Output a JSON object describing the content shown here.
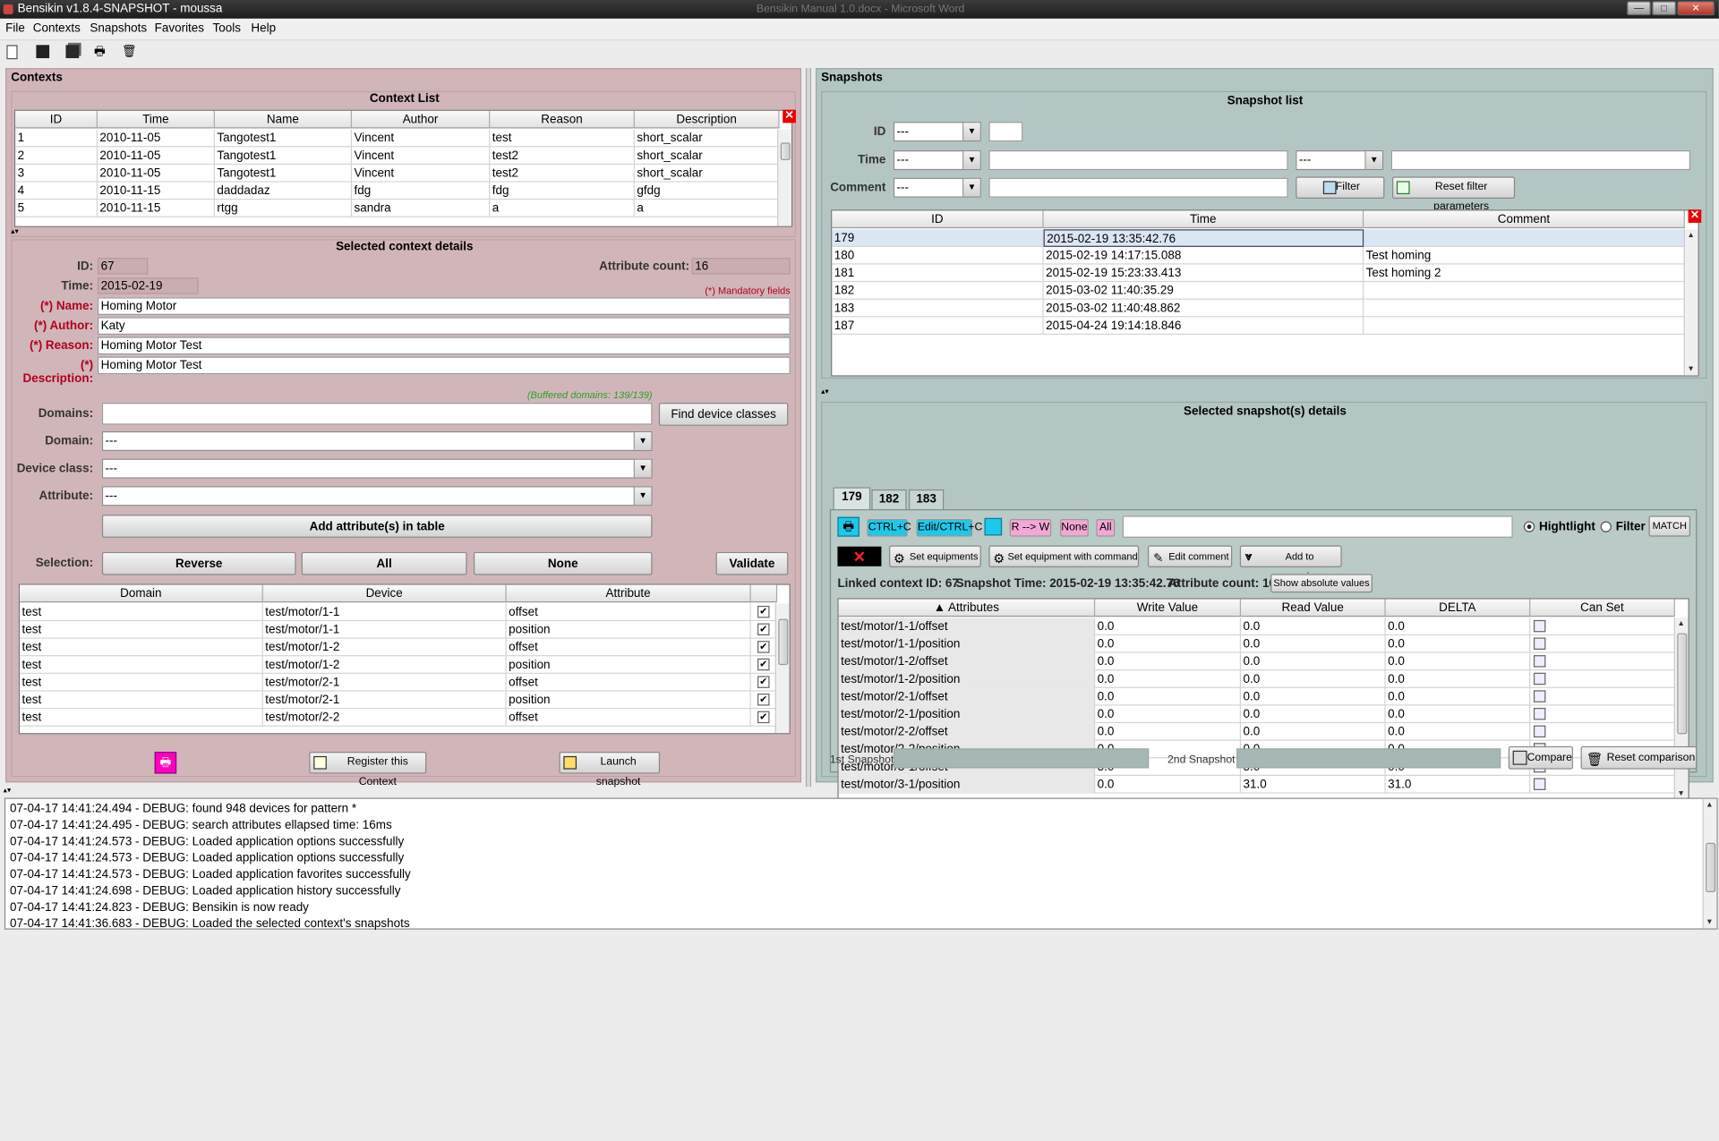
{
  "window": {
    "title": "Bensikin v1.8.4-SNAPSHOT - moussa",
    "ghost_title": "Bensikin Manual 1.0.docx - Microsoft Word"
  },
  "menu": [
    "File",
    "Contexts",
    "Snapshots",
    "Favorites",
    "Tools",
    "Help"
  ],
  "contexts": {
    "group_title": "Contexts",
    "list_title": "Context List",
    "columns": [
      "ID",
      "Time",
      "Name",
      "Author",
      "Reason",
      "Description"
    ],
    "rows": [
      [
        "1",
        "2010-11-05",
        "Tangotest1",
        "Vincent",
        "test",
        "short_scalar"
      ],
      [
        "2",
        "2010-11-05",
        "Tangotest1",
        "Vincent",
        "test2",
        "short_scalar"
      ],
      [
        "3",
        "2010-11-05",
        "Tangotest1",
        "Vincent",
        "test2",
        "short_scalar"
      ],
      [
        "4",
        "2010-11-15",
        "daddadaz",
        "fdg",
        "fdg",
        "gfdg"
      ],
      [
        "5",
        "2010-11-15",
        "rtgg",
        "sandra",
        "a",
        "a"
      ]
    ],
    "details_title": "Selected context details",
    "id_label": "ID:",
    "id": "67",
    "attr_count_label": "Attribute count:",
    "attr_count": "16",
    "time_label": "Time:",
    "time": "2015-02-19",
    "mandatory_note": "(*) Mandatory fields",
    "name_label": "(*) Name:",
    "name": "Homing Motor",
    "author_label": "(*) Author:",
    "author": "Katy",
    "reason_label": "(*) Reason:",
    "reason": "Homing Motor Test",
    "description_label": "(*) Description:",
    "description": "Homing Motor Test",
    "buffered_domains": "(Buffered domains: 139/139)",
    "domains_label": "Domains:",
    "domains_value": "",
    "find_device_classes": "Find device classes",
    "domain_label": "Domain:",
    "domain_value": "---",
    "device_class_label": "Device class:",
    "device_class_value": "---",
    "attribute_label": "Attribute:",
    "attribute_value": "---",
    "add_attributes": "Add attribute(s) in table",
    "selection_label": "Selection:",
    "reverse": "Reverse",
    "all": "All",
    "none": "None",
    "validate": "Validate",
    "attr_columns": [
      "Domain",
      "Device",
      "Attribute"
    ],
    "attr_rows": [
      [
        "test",
        "test/motor/1-1",
        "offset"
      ],
      [
        "test",
        "test/motor/1-1",
        "position"
      ],
      [
        "test",
        "test/motor/1-2",
        "offset"
      ],
      [
        "test",
        "test/motor/1-2",
        "position"
      ],
      [
        "test",
        "test/motor/2-1",
        "offset"
      ],
      [
        "test",
        "test/motor/2-1",
        "position"
      ],
      [
        "test",
        "test/motor/2-2",
        "offset"
      ]
    ],
    "register": "Register this Context",
    "launch": "Launch snapshot"
  },
  "snapshots": {
    "group_title": "Snapshots",
    "list_title": "Snapshot list",
    "id_label": "ID",
    "time_label": "Time",
    "comment_label": "Comment",
    "combo_default": "---",
    "filter": "Filter",
    "reset_filter": "Reset filter parameters",
    "columns": [
      "ID",
      "Time",
      "Comment"
    ],
    "rows": [
      [
        "179",
        "2015-02-19 13:35:42.76",
        ""
      ],
      [
        "180",
        "2015-02-19 14:17:15.088",
        "Test homing"
      ],
      [
        "181",
        "2015-02-19 15:23:33.413",
        "Test homing 2"
      ],
      [
        "182",
        "2015-03-02 11:40:35.29",
        ""
      ],
      [
        "183",
        "2015-03-02 11:40:48.862",
        ""
      ],
      [
        "187",
        "2015-04-24 19:14:18.846",
        ""
      ]
    ],
    "details_title": "Selected snapshot(s) details",
    "tabs": [
      "179",
      "182",
      "183"
    ],
    "ctrl_c": "CTRL+C",
    "edit_ctrl_c": "Edit/CTRL+C",
    "r_to_w": "R --> W",
    "none": "None",
    "all": "All",
    "highlight": "Hightlight",
    "filter_radio": "Filter",
    "match": "MATCH",
    "set_equipments": "Set equipments",
    "set_equipment_cmd": "Set equipment with command",
    "edit_comment": "Edit comment",
    "add_comparison": "Add to comparison",
    "linked_context": "Linked context ID: 67",
    "snapshot_time": "Snapshot Time: 2015-02-19 13:35:42.76",
    "attribute_count": "Attribute count: 16",
    "show_absolute": "Show absolute values",
    "detail_columns": [
      "Attributes",
      "Write Value",
      "Read Value",
      "DELTA",
      "Can Set"
    ],
    "detail_rows": [
      [
        "test/motor/1-1/offset",
        "0.0",
        "0.0",
        "0.0"
      ],
      [
        "test/motor/1-1/position",
        "0.0",
        "0.0",
        "0.0"
      ],
      [
        "test/motor/1-2/offset",
        "0.0",
        "0.0",
        "0.0"
      ],
      [
        "test/motor/1-2/position",
        "0.0",
        "0.0",
        "0.0"
      ],
      [
        "test/motor/2-1/offset",
        "0.0",
        "0.0",
        "0.0"
      ],
      [
        "test/motor/2-1/position",
        "0.0",
        "0.0",
        "0.0"
      ],
      [
        "test/motor/2-2/offset",
        "0.0",
        "0.0",
        "0.0"
      ],
      [
        "test/motor/2-2/position",
        "0.0",
        "0.0",
        "0.0"
      ],
      [
        "test/motor/3-1/offset",
        "5.0",
        "5.0",
        "0.0"
      ],
      [
        "test/motor/3-1/position",
        "0.0",
        "31.0",
        "31.0"
      ]
    ],
    "first_snapshot": "1st Snapshot",
    "second_snapshot": "2nd Snapshot",
    "compare": "Compare",
    "reset_comparison": "Reset comparison"
  },
  "log": [
    "07-04-17 14:41:24.494 - DEBUG: found  948 devices for pattern *",
    "07-04-17 14:41:24.495 - DEBUG: search attributes ellapsed time: 16ms",
    "07-04-17 14:41:24.573 - DEBUG: Loaded application options successfully",
    "07-04-17 14:41:24.573 - DEBUG: Loaded application options successfully",
    "07-04-17 14:41:24.573 - DEBUG: Loaded application favorites successfully",
    "07-04-17 14:41:24.698 - DEBUG: Loaded application history successfully",
    "07-04-17 14:41:24.823 - DEBUG: Bensikin is now ready",
    "07-04-17 14:41:36.683 - DEBUG: Loaded the selected context's snapshots"
  ],
  "colors": {
    "context_bg": "#d1b6b9",
    "snapshot_bg": "#b4c6c3",
    "selected_row": "#dbe6f4",
    "cyan_btn": "#1ec8e8",
    "pink_btn": "#f3a7d6"
  },
  "icons": [
    "new-icon",
    "save-icon",
    "save-all-icon",
    "print-icon",
    "trash-icon"
  ]
}
